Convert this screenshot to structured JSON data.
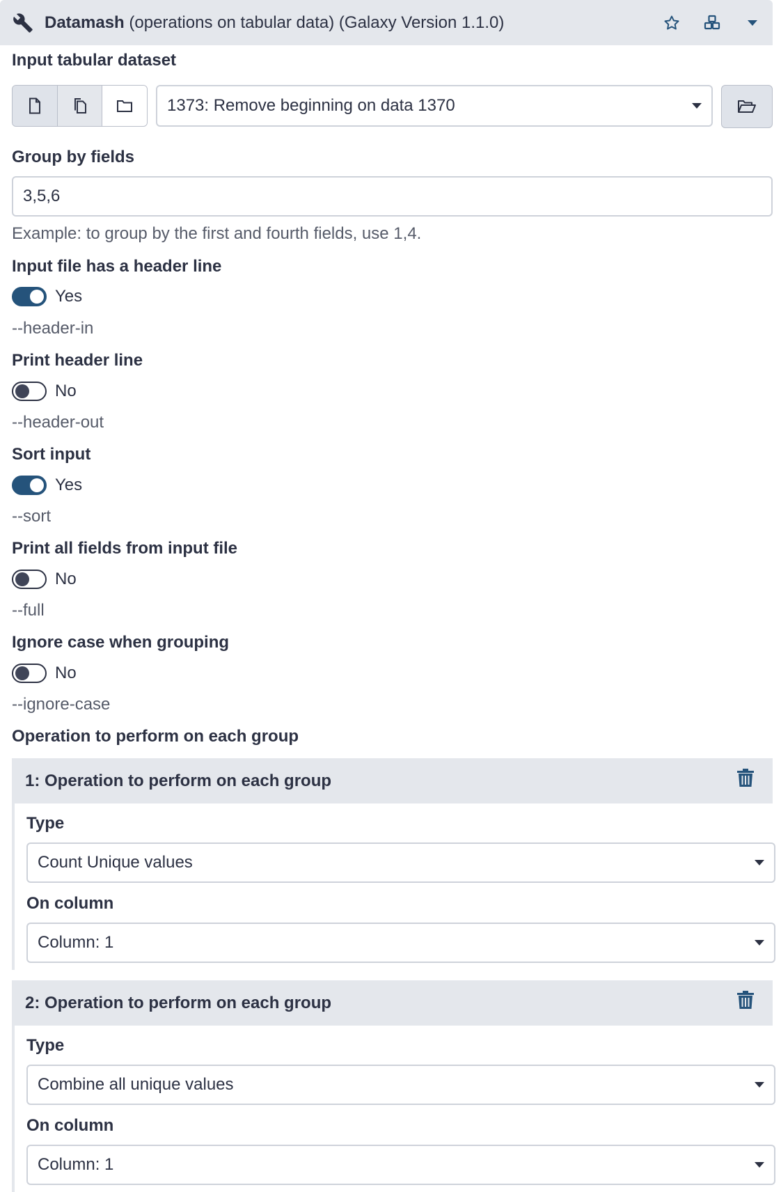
{
  "tool": {
    "name": "Datamash",
    "description": "(operations on tabular data) (Galaxy Version 1.1.0)"
  },
  "input_dataset": {
    "label": "Input tabular dataset",
    "selected": "1373: Remove beginning on data 1370"
  },
  "group_by": {
    "label": "Group by fields",
    "value": "3,5,6",
    "help": "Example: to group by the first and fourth fields, use 1,4."
  },
  "toggles": [
    {
      "label": "Input file has a header line",
      "state": "Yes",
      "on": true,
      "flag": "--header-in"
    },
    {
      "label": "Print header line",
      "state": "No",
      "on": false,
      "flag": "--header-out"
    },
    {
      "label": "Sort input",
      "state": "Yes",
      "on": true,
      "flag": "--sort"
    },
    {
      "label": "Print all fields from input file",
      "state": "No",
      "on": false,
      "flag": "--full"
    },
    {
      "label": "Ignore case when grouping",
      "state": "No",
      "on": false,
      "flag": "--ignore-case"
    }
  ],
  "operations": {
    "label": "Operation to perform on each group",
    "items": [
      {
        "title": "1: Operation to perform on each group",
        "type_label": "Type",
        "type_value": "Count Unique values",
        "column_label": "On column",
        "column_value": "Column: 1"
      },
      {
        "title": "2: Operation to perform on each group",
        "type_label": "Type",
        "type_value": "Combine all unique values",
        "column_label": "On column",
        "column_value": "Column: 1"
      }
    ]
  },
  "colors": {
    "toggle_on": "#25537b",
    "header_bg": "#e4e7ec",
    "text": "#2c3143"
  }
}
